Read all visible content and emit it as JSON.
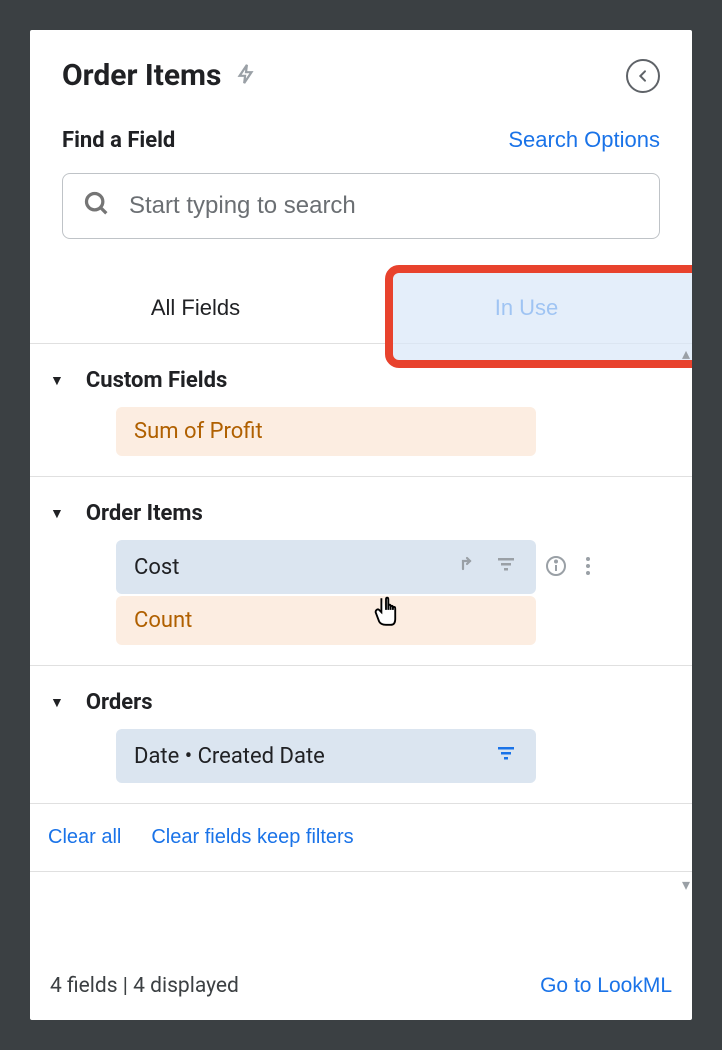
{
  "header": {
    "title": "Order Items"
  },
  "find": {
    "label": "Find a Field",
    "search_options": "Search Options",
    "placeholder": "Start typing to search"
  },
  "tabs": {
    "all_fields": "All Fields",
    "in_use": "In Use"
  },
  "groups": [
    {
      "name": "Custom Fields",
      "fields": [
        {
          "label": "Sum of Profit",
          "style": "orange"
        }
      ]
    },
    {
      "name": "Order Items",
      "fields": [
        {
          "label": "Cost",
          "style": "blue",
          "hovered": true
        },
        {
          "label": "Count",
          "style": "orange"
        }
      ]
    },
    {
      "name": "Orders",
      "fields": [
        {
          "label": "Date • Created Date",
          "style": "blue",
          "has_filter": true
        }
      ]
    }
  ],
  "actions": {
    "clear_all": "Clear all",
    "clear_keep_filters": "Clear fields keep filters"
  },
  "footer": {
    "status": "4 fields | 4 displayed",
    "lookml_link": "Go to LookML"
  }
}
